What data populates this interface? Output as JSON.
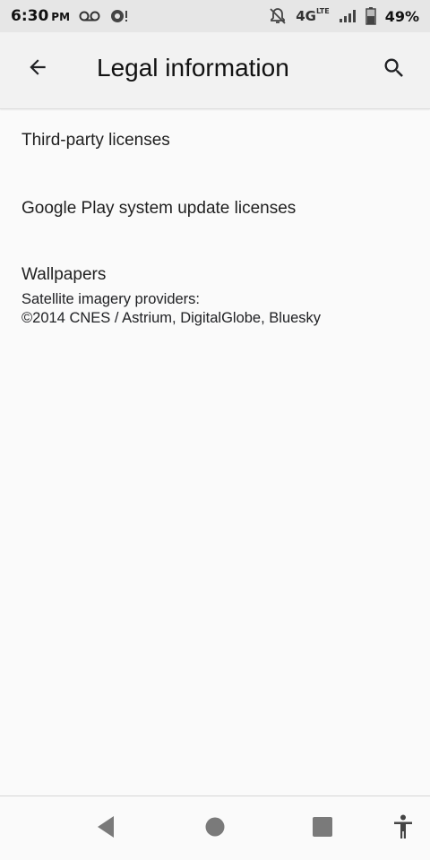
{
  "status_bar": {
    "time": "6:30",
    "ampm": "PM",
    "network": "4G",
    "network_sub": "LTE",
    "battery": "49%",
    "icons": [
      "voicemail-icon",
      "sync-alert-icon",
      "notifications-off-icon",
      "signal-icon",
      "battery-icon"
    ]
  },
  "app_bar": {
    "title": "Legal information",
    "back_icon": "arrow-back-icon",
    "search_icon": "search-icon"
  },
  "list": {
    "items": [
      {
        "title": "Third-party licenses"
      },
      {
        "title": "Google Play system update licenses"
      },
      {
        "title": "Wallpapers",
        "summary_line1": "Satellite imagery providers:",
        "summary_line2": "©2014 CNES / Astrium, DigitalGlobe, Bluesky"
      }
    ]
  },
  "nav_bar": {
    "icons": [
      "nav-back-icon",
      "nav-home-icon",
      "nav-recents-icon",
      "accessibility-icon"
    ]
  },
  "colors": {
    "status_bar_bg": "#e6e6e6",
    "app_bar_bg": "#f2f2f2",
    "page_bg": "#fafafa",
    "nav_icon": "#7a7a7a"
  }
}
